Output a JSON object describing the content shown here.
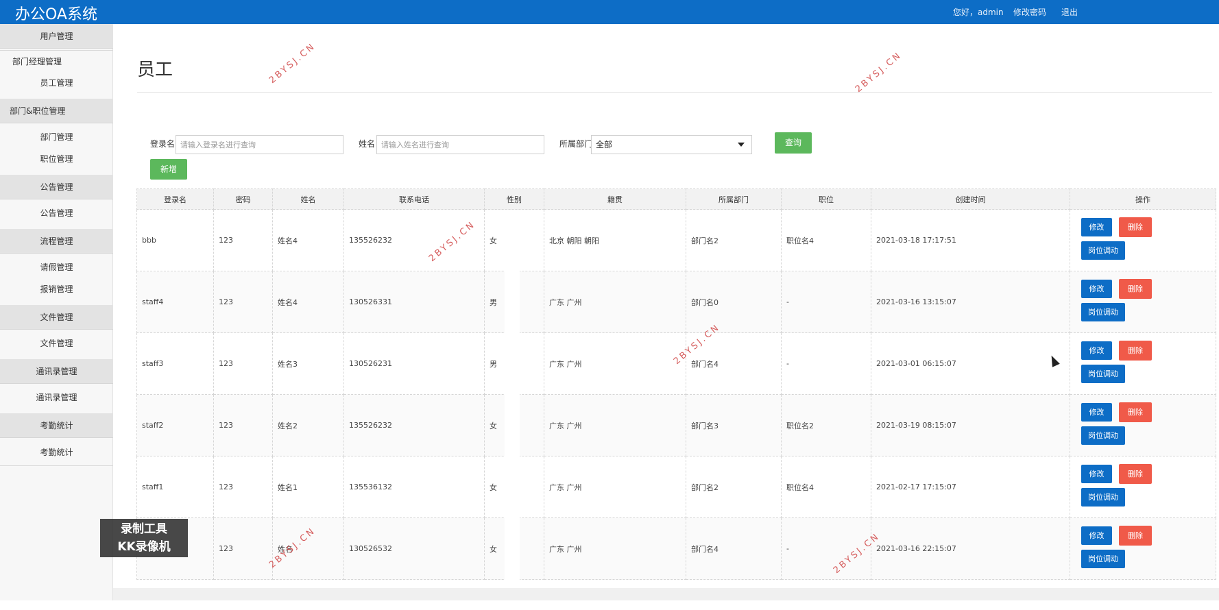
{
  "app": {
    "title": "办公OA系统"
  },
  "topbar": {
    "greeting": "您好，admin",
    "change_password": "修改密码",
    "logout": "退出"
  },
  "sidebar": {
    "items": [
      {
        "label": "用户管理",
        "type": "group"
      },
      {
        "label": "部门经理管理",
        "type": "sub"
      },
      {
        "label": "员工管理",
        "type": "sub"
      },
      {
        "label": "部门&职位管理",
        "type": "group"
      },
      {
        "label": "部门管理",
        "type": "sub"
      },
      {
        "label": "职位管理",
        "type": "sub"
      },
      {
        "label": "公告管理",
        "type": "group"
      },
      {
        "label": "公告管理",
        "type": "sub"
      },
      {
        "label": "流程管理",
        "type": "group"
      },
      {
        "label": "请假管理",
        "type": "sub"
      },
      {
        "label": "报销管理",
        "type": "sub"
      },
      {
        "label": "文件管理",
        "type": "group"
      },
      {
        "label": "文件管理",
        "type": "sub"
      },
      {
        "label": "通讯录管理",
        "type": "group"
      },
      {
        "label": "通讯录管理",
        "type": "sub"
      },
      {
        "label": "考勤统计",
        "type": "group"
      },
      {
        "label": "考勤统计",
        "type": "sub"
      }
    ]
  },
  "page": {
    "title": "员工"
  },
  "filters": {
    "login_label": "登录名",
    "login_placeholder": "请输入登录名进行查询",
    "name_label": "姓名",
    "name_placeholder": "请输入姓名进行查询",
    "dept_label": "所属部门",
    "dept_value": "全部",
    "query_button": "查询",
    "add_button": "新增"
  },
  "table": {
    "headers": [
      "登录名",
      "密码",
      "姓名",
      "联系电话",
      "性别",
      "籍贯",
      "所属部门",
      "职位",
      "创建时间",
      "操作"
    ],
    "actions": {
      "edit": "修改",
      "delete": "删除",
      "transfer": "岗位调动"
    },
    "rows": [
      [
        "bbb",
        "123",
        "姓名4",
        "135526232",
        "女",
        "北京 朝阳 朝阳",
        "部门名2",
        "职位名4",
        "2021-03-18 17:17:51"
      ],
      [
        "staff4",
        "123",
        "姓名4",
        "130526331",
        "男",
        "广东 广州",
        "部门名0",
        "-",
        "2021-03-16 13:15:07"
      ],
      [
        "staff3",
        "123",
        "姓名3",
        "130526231",
        "男",
        "广东 广州",
        "部门名4",
        "-",
        "2021-03-01 06:15:07"
      ],
      [
        "staff2",
        "123",
        "姓名2",
        "135526232",
        "女",
        "广东 广州",
        "部门名3",
        "职位名2",
        "2021-03-19 08:15:07"
      ],
      [
        "staff1",
        "123",
        "姓名1",
        "135536132",
        "女",
        "广东 广州",
        "部门名2",
        "职位名4",
        "2021-02-17 17:15:07"
      ],
      [
        "",
        "123",
        "姓名",
        "130526532",
        "女",
        "广东 广州",
        "部门名4",
        "-",
        "2021-03-16 22:15:07"
      ]
    ]
  },
  "watermark": {
    "text": "2BYSJ.CN"
  },
  "recorder_badge": {
    "line1": "录制工具",
    "line2": "KK录像机"
  },
  "colors": {
    "brand": "#0d6dc6",
    "success": "#5cb85c",
    "danger": "#f05a49"
  }
}
